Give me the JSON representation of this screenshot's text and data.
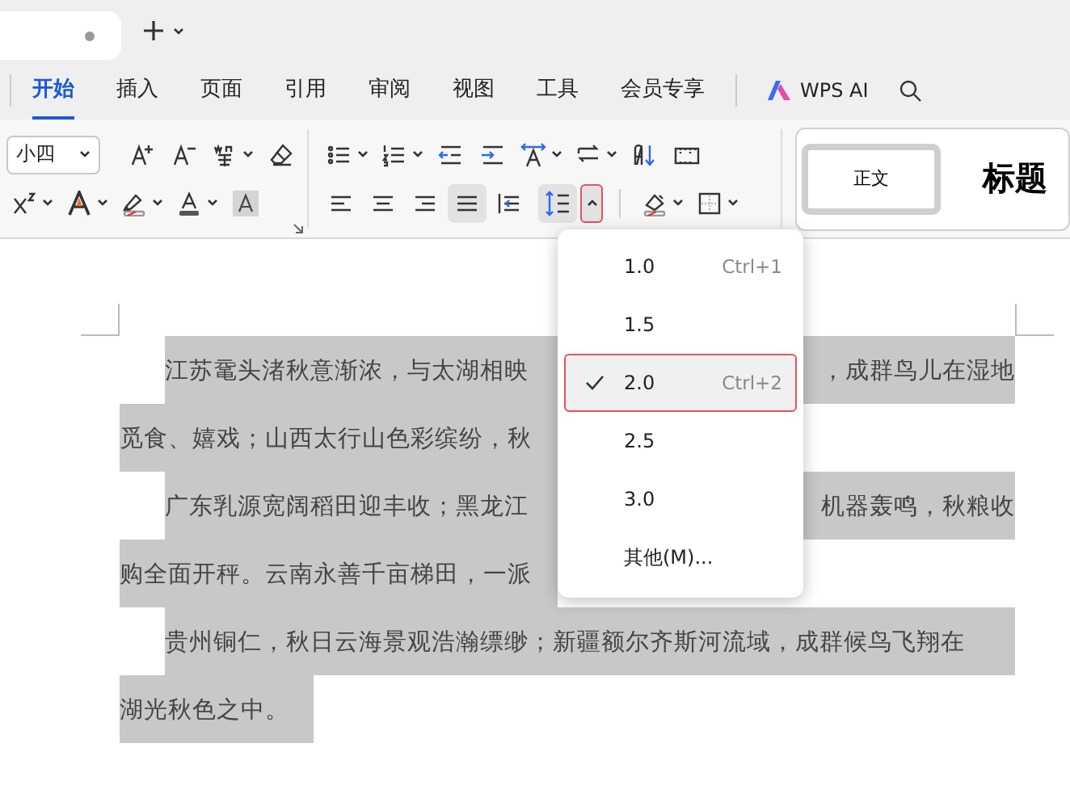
{
  "menu_tabs": [
    {
      "label": "开始",
      "selected": true
    },
    {
      "label": "插入",
      "selected": false
    },
    {
      "label": "页面",
      "selected": false
    },
    {
      "label": "引用",
      "selected": false
    },
    {
      "label": "审阅",
      "selected": false
    },
    {
      "label": "视图",
      "selected": false
    },
    {
      "label": "工具",
      "selected": false
    },
    {
      "label": "会员专享",
      "selected": false
    }
  ],
  "wps_ai": {
    "label": "WPS AI"
  },
  "font_size": {
    "value": "小四"
  },
  "alignment_buttons": [
    {
      "kind": "left",
      "selected": false
    },
    {
      "kind": "center",
      "selected": false
    },
    {
      "kind": "right",
      "selected": false
    },
    {
      "kind": "justify",
      "selected": true
    },
    {
      "kind": "distributed",
      "selected": false
    }
  ],
  "line_spacing_button": {
    "expanded": true
  },
  "styles": [
    {
      "label": "正文",
      "selected": true
    },
    {
      "label": "标题",
      "selected": false
    }
  ],
  "line_spacing_menu": {
    "items": [
      {
        "label": "1.0",
        "shortcut": "Ctrl+1",
        "selected": false
      },
      {
        "label": "1.5",
        "selected": false
      },
      {
        "label": "2.0",
        "shortcut": "Ctrl+2",
        "selected": true
      },
      {
        "label": "2.5",
        "selected": false
      },
      {
        "label": "3.0",
        "selected": false
      },
      {
        "label": "其他(M)...",
        "selected": false
      }
    ]
  },
  "document": {
    "lines": [
      {
        "indent": true,
        "left": "江苏鼋头渚秋意渐浓，与太湖相映",
        "right": "，成群鸟儿在湿地"
      },
      {
        "indent": false,
        "left": "觅食、嬉戏；山西太行山色彩缤纷，秋"
      },
      {
        "indent": true,
        "left": "广东乳源宽阔稻田迎丰收；黑龙江",
        "right": "机器轰鸣，秋粮收"
      },
      {
        "indent": false,
        "left": "购全面开秤。云南永善千亩梯田，一派"
      },
      {
        "indent": true,
        "left": "贵州铜仁，秋日云海景观浩瀚缥缈；新疆额尔齐斯河流域，成群候鸟飞翔在",
        "full": true
      },
      {
        "indent": false,
        "left": "湖光秋色之中。",
        "short": true
      }
    ]
  }
}
